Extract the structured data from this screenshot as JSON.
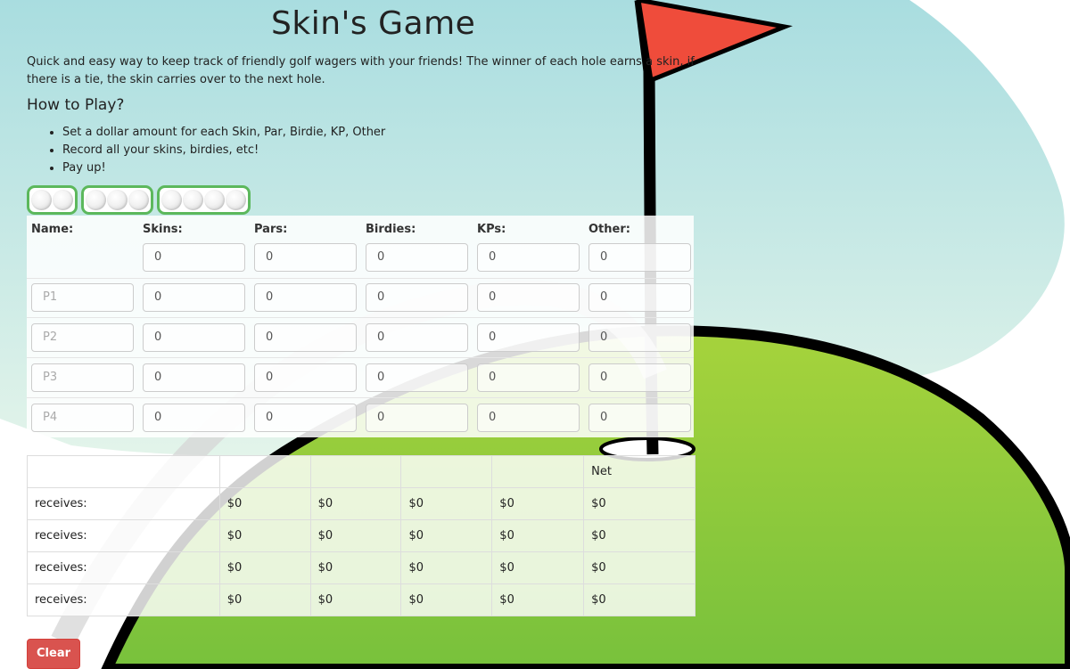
{
  "page": {
    "title": "Skin's Game",
    "intro": "Quick and easy way to keep track of friendly golf wagers with your friends! The winner of each hole earns a skin, if there is a tie, the skin carries over to the next hole.",
    "howto_heading": "How to Play?",
    "steps": [
      "Set a dollar amount for each Skin, Par, Birdie, KP, Other",
      "Record all your skins, birdies, etc!",
      "Pay up!"
    ]
  },
  "player_buttons": [
    {
      "balls": 2
    },
    {
      "balls": 3
    },
    {
      "balls": 4
    }
  ],
  "grid": {
    "headers": [
      "Name:",
      "Skins:",
      "Pars:",
      "Birdies:",
      "KPs:",
      "Other:"
    ],
    "amounts": [
      "0",
      "0",
      "0",
      "0",
      "0"
    ],
    "players": [
      {
        "placeholder": "P1",
        "values": [
          "0",
          "0",
          "0",
          "0",
          "0"
        ]
      },
      {
        "placeholder": "P2",
        "values": [
          "0",
          "0",
          "0",
          "0",
          "0"
        ]
      },
      {
        "placeholder": "P3",
        "values": [
          "0",
          "0",
          "0",
          "0",
          "0"
        ]
      },
      {
        "placeholder": "P4",
        "values": [
          "0",
          "0",
          "0",
          "0",
          "0"
        ]
      }
    ]
  },
  "results": {
    "header": [
      "",
      "",
      "",
      "",
      "",
      "Net"
    ],
    "rows": [
      [
        "receives:",
        "$0",
        "$0",
        "$0",
        "$0",
        "$0"
      ],
      [
        "receives:",
        "$0",
        "$0",
        "$0",
        "$0",
        "$0"
      ],
      [
        "receives:",
        "$0",
        "$0",
        "$0",
        "$0",
        "$0"
      ],
      [
        "receives:",
        "$0",
        "$0",
        "$0",
        "$0",
        "$0"
      ]
    ]
  },
  "actions": {
    "clear_label": "Clear"
  },
  "colors": {
    "sky": "#b9e2e4",
    "green": "#8cc63f",
    "flag": "#e74c3c",
    "button_green": "#5cb85c",
    "clear_red": "#d9534f"
  }
}
